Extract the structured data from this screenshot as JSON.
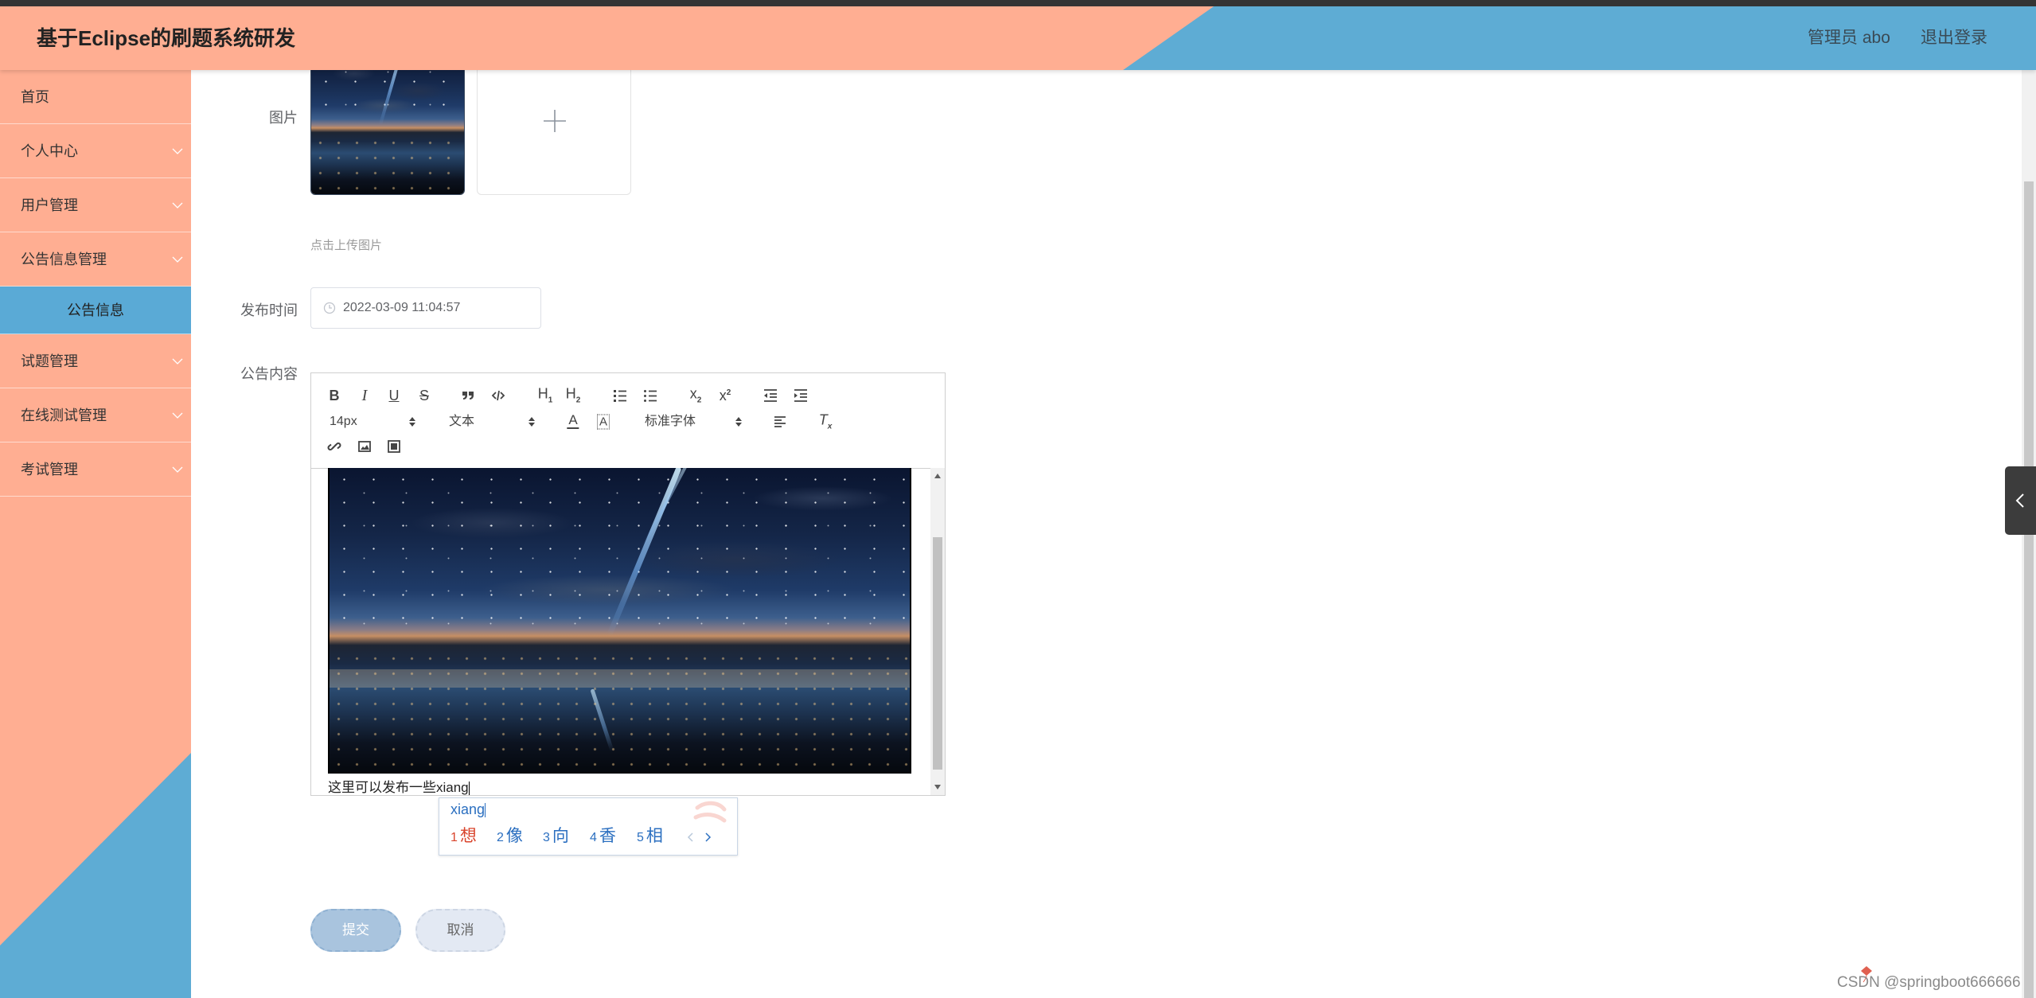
{
  "app": {
    "title": "基于Eclipse的刷题系统研发",
    "user": "管理员 abo",
    "logout": "退出登录"
  },
  "colors": {
    "header_salmon": "#ffae92",
    "header_blue": "#5eacd4",
    "menu_active": "#5aaad6",
    "submit_button": "#a9c4de",
    "cancel_button": "#e3e9f3",
    "ime_highlight": "#d9442c"
  },
  "sidebar": {
    "items": [
      {
        "label": "首页",
        "expandable": false
      },
      {
        "label": "个人中心",
        "expandable": true
      },
      {
        "label": "用户管理",
        "expandable": true
      },
      {
        "label": "公告信息管理",
        "expandable": true,
        "expanded": true
      },
      {
        "label": "公告信息",
        "submenu": true,
        "active": true
      },
      {
        "label": "试题管理",
        "expandable": true
      },
      {
        "label": "在线测试管理",
        "expandable": true
      },
      {
        "label": "考试管理",
        "expandable": true
      }
    ]
  },
  "form": {
    "image_label": "图片",
    "upload_hint": "点击上传图片",
    "publish_time_label": "发布时间",
    "publish_time_value": "2022-03-09 11:04:57",
    "content_label": "公告内容",
    "submit": "提交",
    "cancel": "取消"
  },
  "editor": {
    "toolbar": {
      "bold": "B",
      "italic": "I",
      "underline": "U",
      "strike": "S",
      "h1": {
        "base": "H",
        "index": "1"
      },
      "h2": {
        "base": "H",
        "index": "2"
      },
      "subscript": {
        "base": "x",
        "index": "2"
      },
      "superscript": {
        "base": "x",
        "index": "2"
      },
      "font_size": "14px",
      "header": "文本",
      "font_family": "标准字体",
      "text_color": "A",
      "background_color": "A",
      "clean": {
        "base": "T",
        "index": "x"
      },
      "icons": [
        "blockquote-icon",
        "code-block-icon",
        "ordered-list-icon",
        "bullet-list-icon",
        "outdent-icon",
        "indent-icon",
        "align-icon",
        "link-icon",
        "image-icon",
        "video-icon"
      ]
    },
    "content_text": "这里可以发布一些xiang"
  },
  "ime": {
    "pinyin": "xiang",
    "candidates": [
      {
        "num": "1",
        "char": "想",
        "highlighted": true
      },
      {
        "num": "2",
        "char": "像"
      },
      {
        "num": "3",
        "char": "向"
      },
      {
        "num": "4",
        "char": "香"
      },
      {
        "num": "5",
        "char": "相"
      }
    ]
  },
  "watermark": "CSDN @springboot666666"
}
